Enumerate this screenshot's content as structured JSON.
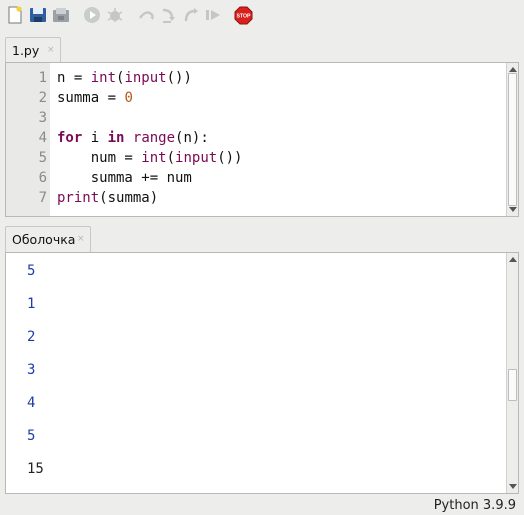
{
  "toolbar": {
    "icons": [
      "new-file-icon",
      "open-file-icon",
      "save-file-icon",
      "run-icon",
      "debug-icon",
      "step-over-icon",
      "step-into-icon",
      "step-out-icon",
      "resume-icon",
      "stop-icon"
    ],
    "stop_label": "STOP"
  },
  "editor": {
    "tab_label": "1.py",
    "tab_close": "×",
    "line_numbers": [
      "1",
      "2",
      "3",
      "4",
      "5",
      "6",
      "7"
    ],
    "lines": [
      [
        {
          "t": "n = ",
          "c": ""
        },
        {
          "t": "int",
          "c": "bi"
        },
        {
          "t": "(",
          "c": ""
        },
        {
          "t": "input",
          "c": "bi"
        },
        {
          "t": "())",
          "c": ""
        }
      ],
      [
        {
          "t": "summa = ",
          "c": ""
        },
        {
          "t": "0",
          "c": "num"
        }
      ],
      [],
      [
        {
          "t": "for",
          "c": "kw"
        },
        {
          "t": " i ",
          "c": ""
        },
        {
          "t": "in",
          "c": "kw"
        },
        {
          "t": " ",
          "c": ""
        },
        {
          "t": "range",
          "c": "bi"
        },
        {
          "t": "(n):",
          "c": ""
        }
      ],
      [
        {
          "t": "    num = ",
          "c": ""
        },
        {
          "t": "int",
          "c": "bi"
        },
        {
          "t": "(",
          "c": ""
        },
        {
          "t": "input",
          "c": "bi"
        },
        {
          "t": "())",
          "c": ""
        }
      ],
      [
        {
          "t": "    summa += num",
          "c": ""
        }
      ],
      [
        {
          "t": "print",
          "c": "bi"
        },
        {
          "t": "(summa)",
          "c": ""
        }
      ]
    ]
  },
  "shell": {
    "tab_label": "Оболочка",
    "tab_close": "×",
    "outputs": [
      "5",
      "1",
      "2",
      "3",
      "4",
      "5",
      "15"
    ]
  },
  "status": {
    "interpreter": "Python 3.9.9"
  },
  "colors": {
    "keyword": "#7a0a55",
    "number": "#b3591a",
    "input_echo": "#1e3da8",
    "stop_red": "#d8201c"
  }
}
